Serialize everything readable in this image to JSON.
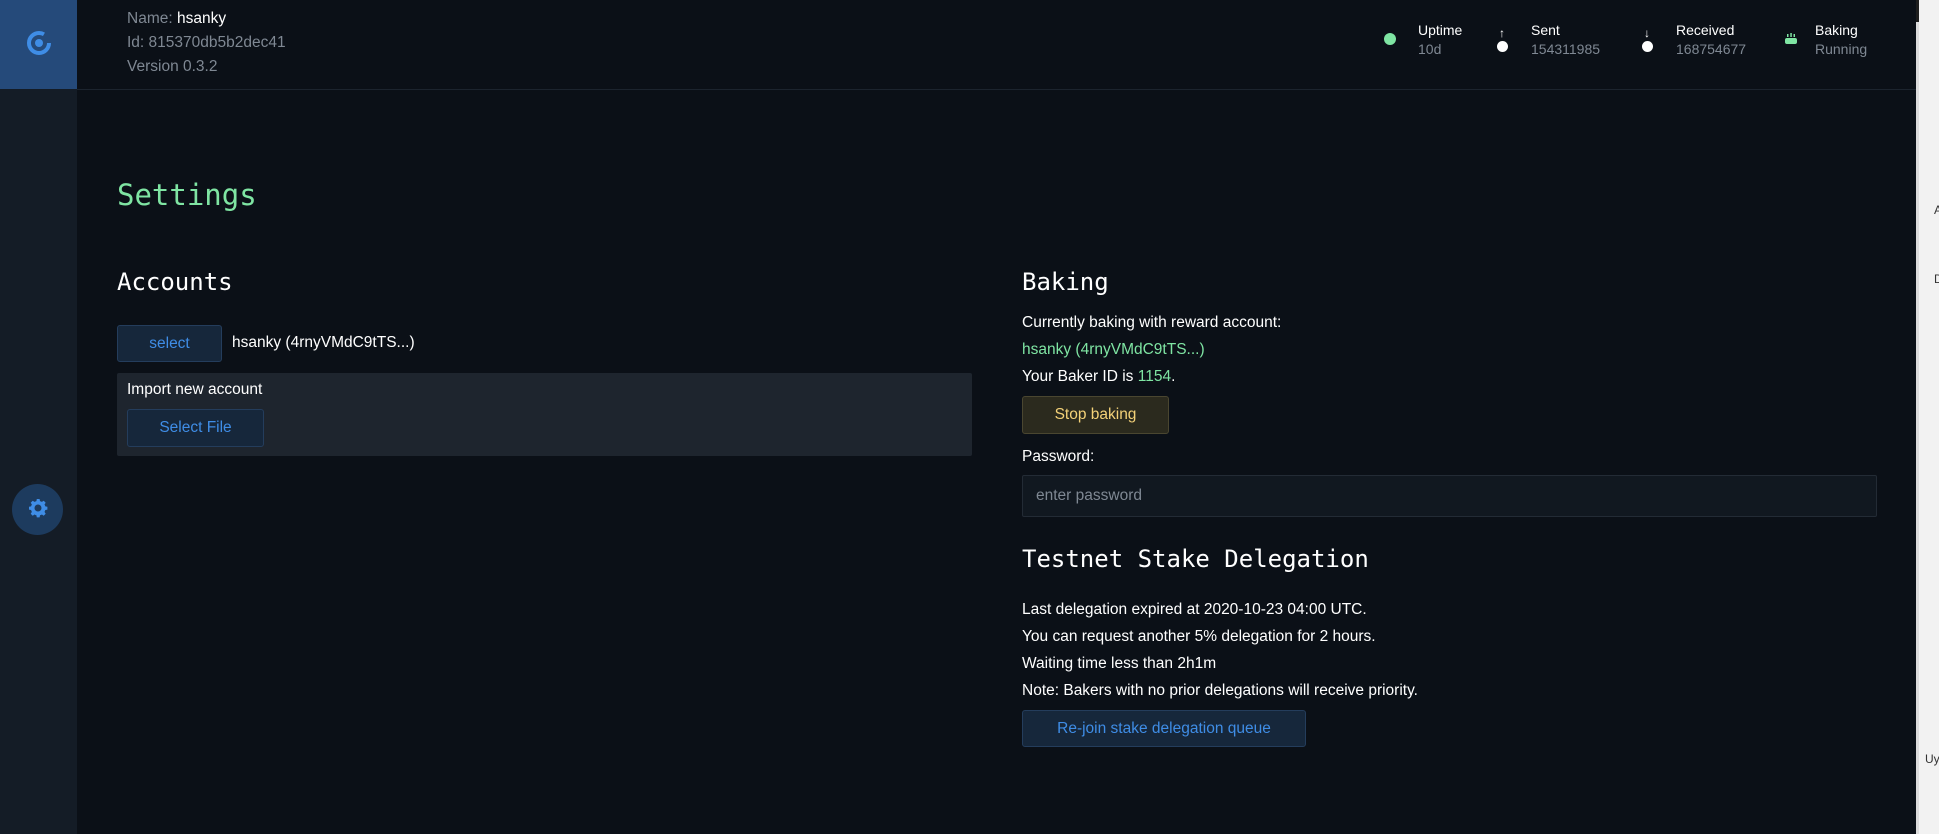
{
  "node": {
    "name_label": "Name:",
    "name_value": "hsanky",
    "id_text": "Id: 815370db5b2dec41",
    "version_text": "Version 0.3.2"
  },
  "stats": {
    "uptime": {
      "label": "Uptime",
      "value": "10d"
    },
    "sent": {
      "label": "Sent",
      "value": "154311985"
    },
    "received": {
      "label": "Received",
      "value": "168754677"
    },
    "baking": {
      "label": "Baking",
      "value": "Running"
    }
  },
  "colors": {
    "accent_green": "#7fe5a3",
    "accent_blue": "#3f8de6",
    "warn_yellow": "#f3d178",
    "sidebar_logo_bg": "#254a7a"
  },
  "icons": {
    "logo": "concordium-logo-icon",
    "settings": "gear-icon",
    "uptime": "status-dot-icon",
    "sent": "arrow-up-icon",
    "received": "arrow-down-icon",
    "baking": "baking-icon"
  },
  "page": {
    "title": "Settings"
  },
  "accounts": {
    "heading": "Accounts",
    "select_label": "select",
    "current_account": "hsanky (4rnyVMdC9tTS...)",
    "import_label": "Import new account",
    "select_file_label": "Select File"
  },
  "baking": {
    "heading": "Baking",
    "currently_text": "Currently baking with reward account:",
    "reward_account": "hsanky (4rnyVMdC9tTS...)",
    "baker_id_prefix": "Your Baker ID is ",
    "baker_id": "1154",
    "baker_id_suffix": ".",
    "stop_label": "Stop baking",
    "password_label": "Password:",
    "password_placeholder": "enter password",
    "password_value": ""
  },
  "delegation": {
    "heading": "Testnet Stake Delegation",
    "line1": "Last delegation expired at 2020-10-23 04:00 UTC.",
    "line2": "You can request another 5% delegation for 2 hours.",
    "line3": "Waiting time less than 2h1m",
    "line4": "Note: Bakers with no prior delegations will receive priority.",
    "rejoin_label": "Re-join stake delegation queue"
  },
  "right_strip": {
    "letters": [
      "A",
      "D",
      "Uy"
    ]
  }
}
